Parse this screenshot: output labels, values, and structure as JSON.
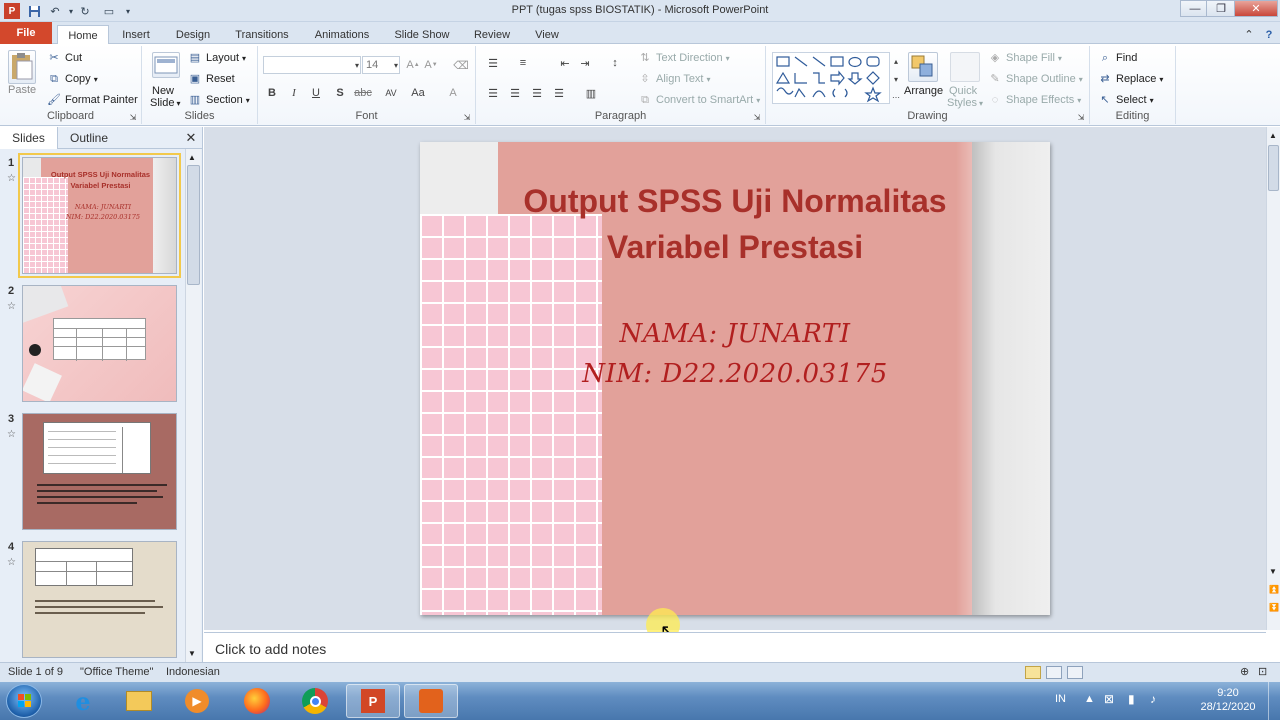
{
  "window": {
    "title": "PPT (tugas spss BIOSTATIK)  -  Microsoft PowerPoint"
  },
  "tabs": [
    {
      "label": "File"
    },
    {
      "label": "Home"
    },
    {
      "label": "Insert"
    },
    {
      "label": "Design"
    },
    {
      "label": "Transitions"
    },
    {
      "label": "Animations"
    },
    {
      "label": "Slide Show"
    },
    {
      "label": "Review"
    },
    {
      "label": "View"
    }
  ],
  "ribbon": {
    "clipboard": {
      "label": "Clipboard",
      "paste": "Paste",
      "cut": "Cut",
      "copy": "Copy",
      "format_painter": "Format Painter"
    },
    "slides": {
      "label": "Slides",
      "new_slide_1": "New",
      "new_slide_2": "Slide",
      "layout": "Layout",
      "reset": "Reset",
      "section": "Section"
    },
    "font": {
      "label": "Font",
      "font_name": "",
      "font_size": "14",
      "bold": "B",
      "italic": "I",
      "underline": "U",
      "shadow": "S",
      "strike": "abc",
      "spacing": "AV",
      "case": "Aa",
      "color": "A"
    },
    "paragraph": {
      "label": "Paragraph",
      "text_direction": "Text Direction",
      "align_text": "Align Text",
      "convert_smartart": "Convert to SmartArt"
    },
    "drawing": {
      "label": "Drawing",
      "arrange": "Arrange",
      "quick_styles_1": "Quick",
      "quick_styles_2": "Styles",
      "shape_fill": "Shape Fill",
      "shape_outline": "Shape Outline",
      "shape_effects": "Shape Effects"
    },
    "editing": {
      "label": "Editing",
      "find": "Find",
      "replace": "Replace",
      "select": "Select"
    }
  },
  "left_pane": {
    "tab_slides": "Slides",
    "tab_outline": "Outline",
    "thumbnails": [
      {
        "num": "1",
        "title_line1": "Output SPSS Uji Normalitas",
        "title_line2": "Variabel Prestasi",
        "sub1": "NAMA: JUNARTI",
        "sub2": "NIM: D22.2020.03175"
      },
      {
        "num": "2"
      },
      {
        "num": "3"
      },
      {
        "num": "4"
      }
    ]
  },
  "slide": {
    "title_line1": "Output SPSS Uji Normalitas",
    "title_line2": "Variabel Prestasi",
    "name_line": "NAMA: JUNARTI",
    "nim_line": "NIM: D22.2020.03175"
  },
  "notes_placeholder": "Click to add notes",
  "status": {
    "slide_info": "Slide 1 of 9",
    "theme": "\"Office Theme\"",
    "language": "Indonesian"
  },
  "taskbar": {
    "lang": "IN",
    "time": "9:20",
    "date": "28/12/2020"
  },
  "colors": {
    "slide_salmon": "#e2a19a",
    "title_red": "#a8302a",
    "file_tab": "#d3482c"
  }
}
